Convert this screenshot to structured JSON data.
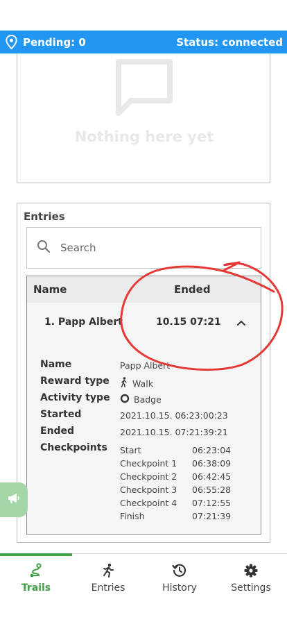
{
  "status_bar": {
    "pending": "Pending: 0",
    "status": "Status: connected",
    "icon": "location-pin-icon"
  },
  "empty_state": {
    "text": "Nothing here yet",
    "icon": "comment-bubble-icon"
  },
  "entries": {
    "title": "Entries",
    "search": {
      "placeholder": "Search",
      "value": ""
    },
    "columns": {
      "name": "Name",
      "ended": "Ended"
    },
    "rows": [
      {
        "name": "1. Papp Albert",
        "ended": "10.15 07:21",
        "expanded": true
      }
    ],
    "details": {
      "name_label": "Name",
      "name_value": "Papp Albert",
      "reward_label": "Reward type",
      "reward_value": "Walk",
      "reward_icon": "walking-person-icon",
      "activity_label": "Activity type",
      "activity_value": "Badge",
      "activity_icon": "badge-circle-icon",
      "started_label": "Started",
      "started_value": "2021.10.15. 06:23:00:23",
      "ended_label": "Ended",
      "ended_value": "2021.10.15. 07:21:39:21",
      "checkpoints_label": "Checkpoints",
      "checkpoints": [
        {
          "name": "Start",
          "time": "06:23:04"
        },
        {
          "name": "Checkpoint 1",
          "time": "06:38:09"
        },
        {
          "name": "Checkpoint 2",
          "time": "06:42:45"
        },
        {
          "name": "Checkpoint 3",
          "time": "06:55:28"
        },
        {
          "name": "Checkpoint 4",
          "time": "07:12:55"
        },
        {
          "name": "Finish",
          "time": "07:21:39"
        }
      ]
    }
  },
  "feedback": {
    "icon": "megaphone-icon"
  },
  "nav": {
    "items": [
      {
        "label": "Trails",
        "icon": "route-icon",
        "active": true
      },
      {
        "label": "Entries",
        "icon": "running-person-icon",
        "active": false
      },
      {
        "label": "History",
        "icon": "history-icon",
        "active": false
      },
      {
        "label": "Settings",
        "icon": "gear-icon",
        "active": false
      }
    ]
  },
  "colors": {
    "status_bar": "#2196f3",
    "nav_active": "#43a047",
    "annotation": "#e53935",
    "feedback_tab": "#a5d6a7"
  }
}
